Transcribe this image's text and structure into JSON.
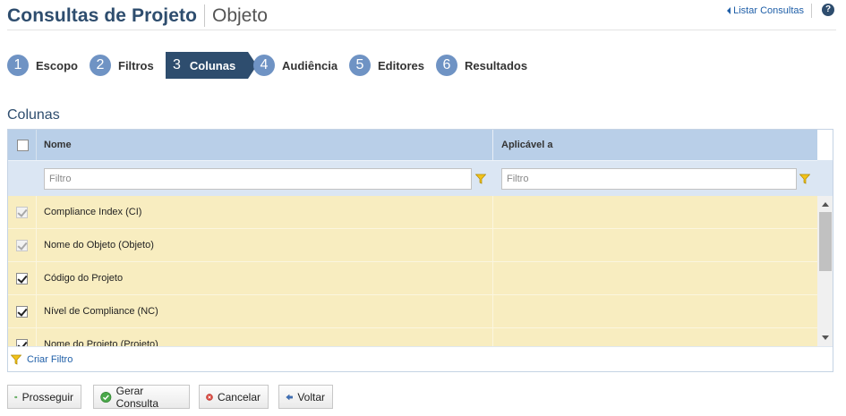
{
  "header": {
    "title": "Consultas de Projeto",
    "subtitle": "Objeto",
    "list_link": "Listar Consultas",
    "help": "?"
  },
  "wizard": {
    "steps": [
      {
        "num": "1",
        "label": "Escopo"
      },
      {
        "num": "2",
        "label": "Filtros"
      },
      {
        "num": "3",
        "label": "Colunas",
        "active": true
      },
      {
        "num": "4",
        "label": "Audiência"
      },
      {
        "num": "5",
        "label": "Editores"
      },
      {
        "num": "6",
        "label": "Resultados"
      }
    ]
  },
  "section": {
    "title": "Colunas"
  },
  "grid": {
    "columns": [
      "Nome",
      "Aplicável a"
    ],
    "filter_placeholders": [
      "Filtro",
      "Filtro"
    ],
    "rows": [
      {
        "name": "Compliance Index (CI)",
        "applies_to": "",
        "checked": true,
        "disabled": true
      },
      {
        "name": "Nome do Objeto (Objeto)",
        "applies_to": "",
        "checked": true,
        "disabled": true
      },
      {
        "name": "Código do Projeto",
        "applies_to": "",
        "checked": true,
        "disabled": false
      },
      {
        "name": "Nível de Compliance (NC)",
        "applies_to": "",
        "checked": true,
        "disabled": false
      },
      {
        "name": "Nome do Projeto (Projeto)",
        "applies_to": "",
        "checked": true,
        "disabled": false
      }
    ],
    "create_filter": "Criar Filtro"
  },
  "actions": {
    "proceed": "Prosseguir",
    "generate": "Gerar Consulta",
    "cancel": "Cancelar",
    "back": "Voltar"
  },
  "colors": {
    "brand": "#2e4d6e",
    "step_circle": "#6f93c4",
    "header_row": "#b9cfe8",
    "filter_row": "#dbe6f3",
    "selected_row": "#f8edc0",
    "link": "#1f5fa8"
  }
}
